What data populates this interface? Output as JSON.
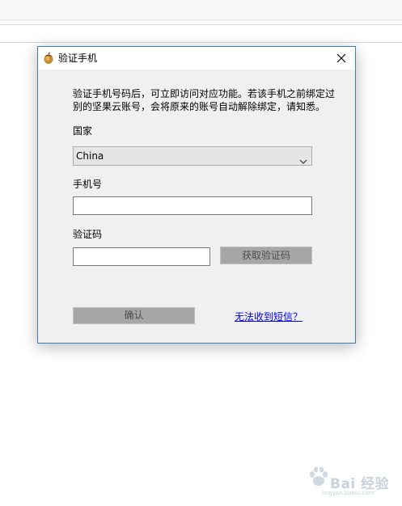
{
  "dialog": {
    "title": "验证手机",
    "close_label": "×",
    "description": "验证手机号码后，可立即访问对应功能。若该手机之前绑定过别的坚果云账号，会将原来的账号自动解除绑定，请知悉。",
    "country": {
      "label": "国家",
      "selected": "China"
    },
    "phone": {
      "label": "手机号",
      "value": ""
    },
    "code": {
      "label": "验证码",
      "value": "",
      "get_code_button": "获取验证码"
    },
    "confirm_button": "确认",
    "no_sms_link": "无法收到短信？"
  },
  "watermark": {
    "text": "Bai 经验",
    "sub": "jingyan.baidu.com"
  },
  "colors": {
    "dialog_bg": "#f0f0f0",
    "border": "#3c7fb1",
    "link": "#0000ee",
    "disabled_button": "#a6a6a6"
  }
}
